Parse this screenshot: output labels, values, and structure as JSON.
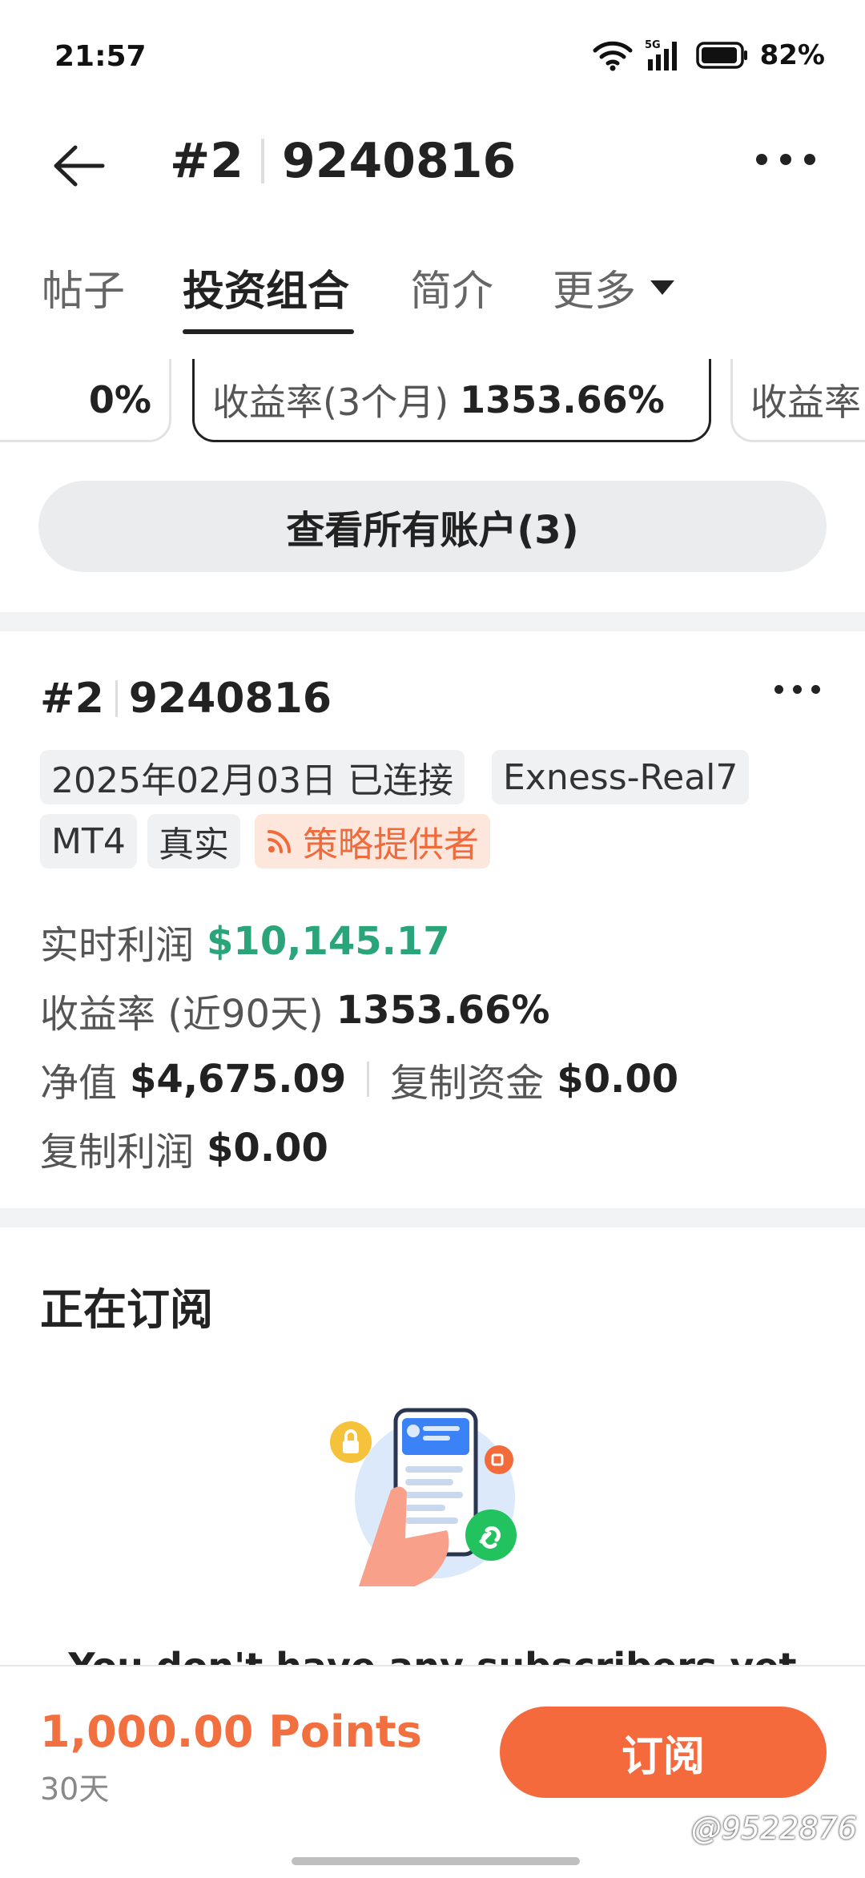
{
  "status_bar": {
    "time": "21:57",
    "network": "5G",
    "battery": "82%",
    "icons": [
      "wifi-icon",
      "signal-icon",
      "battery-icon"
    ]
  },
  "header": {
    "account_index": "#2",
    "account_number": "9240816",
    "icons": [
      "back-arrow-icon",
      "more-icon"
    ]
  },
  "tabs": [
    {
      "label": "帖子",
      "active": false
    },
    {
      "label": "投资组合",
      "active": true
    },
    {
      "label": "简介",
      "active": false
    },
    {
      "label": "更多",
      "active": false
    }
  ],
  "metric_cards": {
    "left_partial": "0%",
    "active_label": "收益率(3个月)",
    "active_value": "1353.66%",
    "right_partial": "收益率"
  },
  "view_all_button": "查看所有账户(3)",
  "account": {
    "index": "#2",
    "number": "9240816",
    "tags": {
      "connected_date": "2025年02月03日 已连接",
      "server": "Exness-Real7",
      "platform": "MT4",
      "type": "真实",
      "role": "策略提供者"
    },
    "stats": {
      "realtime_profit_label": "实时利润",
      "realtime_profit_value": "$10,145.17",
      "return_label": "收益率 (近90天)",
      "return_value": "1353.66%",
      "equity_label": "净值",
      "equity_value": "$4,675.09",
      "copy_funds_label": "复制资金",
      "copy_funds_value": "$0.00",
      "copy_profit_label": "复制利润",
      "copy_profit_value": "$0.00"
    }
  },
  "subscribing": {
    "title": "正在订阅",
    "empty_message": "You don't have any subscribers yet"
  },
  "bottom_bar": {
    "price": "1,000.00 Points",
    "period": "30天",
    "subscribe_label": "订阅",
    "watermark": "@9522876"
  },
  "colors": {
    "accent_orange": "#f56a3d",
    "profit_green": "#2aa57a",
    "provider_tag_bg": "#fde6dc"
  }
}
